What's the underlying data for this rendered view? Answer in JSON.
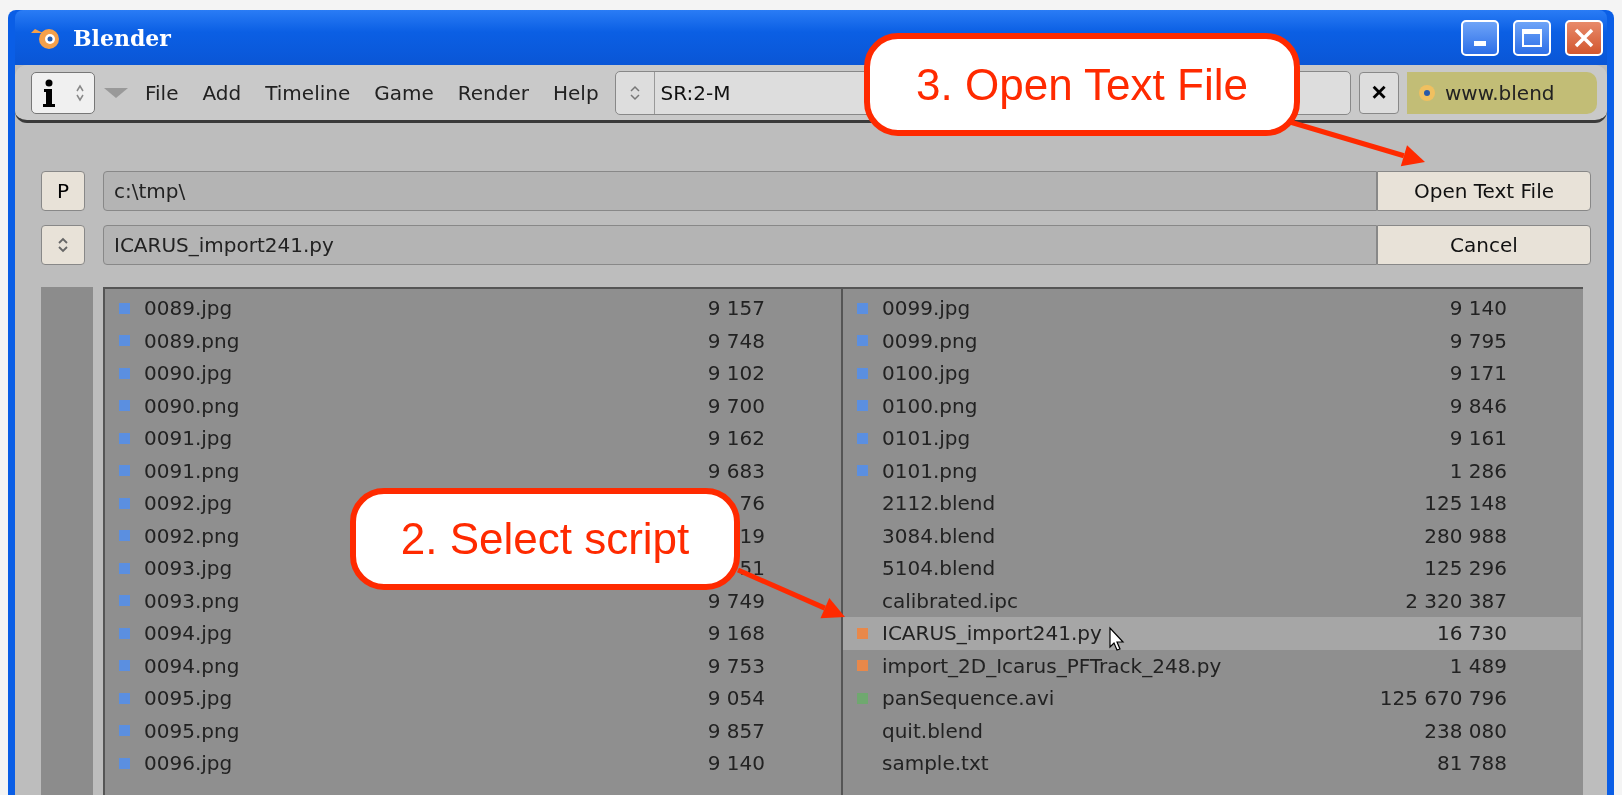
{
  "window": {
    "title": "Blender"
  },
  "toolbar": {
    "menus": [
      "File",
      "Add",
      "Timeline",
      "Game",
      "Render",
      "Help"
    ],
    "scene_field": "SR:2-M",
    "clear_button": "×",
    "link": "www.blend"
  },
  "file_browser": {
    "path": "c:\\tmp\\",
    "filename": "ICARUS_import241.py",
    "parent_button": "P",
    "open_button": "Open Text File",
    "cancel_button": "Cancel",
    "left_list": [
      {
        "name": "0089.jpg",
        "size": "9 157",
        "color": "#5b8fe0",
        "selected": false
      },
      {
        "name": "0089.png",
        "size": "9 748",
        "color": "#5b8fe0",
        "selected": false
      },
      {
        "name": "0090.jpg",
        "size": "9 102",
        "color": "#5b8fe0",
        "selected": false
      },
      {
        "name": "0090.png",
        "size": "9 700",
        "color": "#5b8fe0",
        "selected": false
      },
      {
        "name": "0091.jpg",
        "size": "9 162",
        "color": "#5b8fe0",
        "selected": false
      },
      {
        "name": "0091.png",
        "size": "9 683",
        "color": "#5b8fe0",
        "selected": false
      },
      {
        "name": "0092.jpg",
        "size": "76",
        "color": "#5b8fe0",
        "selected": false
      },
      {
        "name": "0092.png",
        "size": "19",
        "color": "#5b8fe0",
        "selected": false
      },
      {
        "name": "0093.jpg",
        "size": "51",
        "color": "#5b8fe0",
        "selected": false
      },
      {
        "name": "0093.png",
        "size": "9 749",
        "color": "#5b8fe0",
        "selected": false
      },
      {
        "name": "0094.jpg",
        "size": "9 168",
        "color": "#5b8fe0",
        "selected": false
      },
      {
        "name": "0094.png",
        "size": "9 753",
        "color": "#5b8fe0",
        "selected": false
      },
      {
        "name": "0095.jpg",
        "size": "9 054",
        "color": "#5b8fe0",
        "selected": false
      },
      {
        "name": "0095.png",
        "size": "9 857",
        "color": "#5b8fe0",
        "selected": false
      },
      {
        "name": "0096.jpg",
        "size": "9 140",
        "color": "#5b8fe0",
        "selected": false
      }
    ],
    "right_list": [
      {
        "name": "0099.jpg",
        "size": "9 140",
        "color": "#5b8fe0",
        "selected": false
      },
      {
        "name": "0099.png",
        "size": "9 795",
        "color": "#5b8fe0",
        "selected": false
      },
      {
        "name": "0100.jpg",
        "size": "9 171",
        "color": "#5b8fe0",
        "selected": false
      },
      {
        "name": "0100.png",
        "size": "9 846",
        "color": "#5b8fe0",
        "selected": false
      },
      {
        "name": "0101.jpg",
        "size": "9 161",
        "color": "#5b8fe0",
        "selected": false
      },
      {
        "name": "0101.png",
        "size": "1 286",
        "color": "#5b8fe0",
        "selected": false
      },
      {
        "name": "2112.blend",
        "size": "125 148",
        "selected": false
      },
      {
        "name": "3084.blend",
        "size": "280 988",
        "selected": false
      },
      {
        "name": "5104.blend",
        "size": "125 296",
        "selected": false
      },
      {
        "name": "calibrated.ipc",
        "size": "2 320 387",
        "selected": false
      },
      {
        "name": "ICARUS_import241.py",
        "size": "16 730",
        "color": "#e8884a",
        "selected": true
      },
      {
        "name": "import_2D_Icarus_PFTrack_248.py",
        "size": "1 489",
        "color": "#e8884a",
        "selected": false
      },
      {
        "name": "panSequence.avi",
        "size": "125 670 796",
        "color": "#6fa86f",
        "selected": false
      },
      {
        "name": "quit.blend",
        "size": "238 080",
        "selected": false
      },
      {
        "name": "sample.txt",
        "size": "81 788",
        "selected": false
      }
    ]
  },
  "callouts": [
    {
      "kind": "top",
      "text": "3. Open Text File"
    },
    {
      "kind": "mid",
      "text": "2. Select script"
    }
  ]
}
